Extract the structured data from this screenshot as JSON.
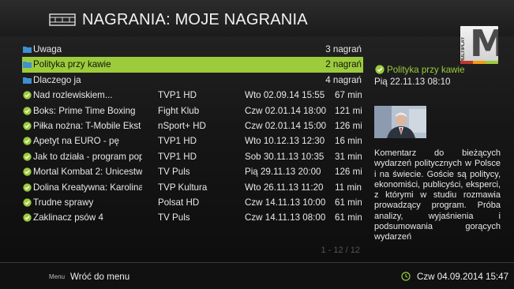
{
  "header": {
    "title": "NAGRANIA: MOJE NAGRANIA",
    "icon": "film-icon"
  },
  "logo": {
    "text": "M",
    "side_text": "MULTIPLAY",
    "bar_colors": [
      "#c0392b",
      "#f39c12",
      "#9ccb3b"
    ]
  },
  "colors": {
    "accent": "#9ccb3b",
    "folder": "#3f8fd2"
  },
  "folders": [
    {
      "name": "Uwaga",
      "count": "3 nagrań",
      "selected": false
    },
    {
      "name": "Polityka przy kawie",
      "count": "2 nagrań",
      "selected": true
    },
    {
      "name": "Dlaczego ja",
      "count": "4 nagrań",
      "selected": false
    }
  ],
  "recordings": [
    {
      "name": "Nad rozlewiskiem...",
      "channel": "TVP1 HD",
      "date": "Wto 02.09.14 15:55",
      "duration": "67 min"
    },
    {
      "name": "Boks: Prime Time Boxing",
      "channel": "Fight Klub",
      "date": "Czw 02.01.14 18:00",
      "duration": "121 min"
    },
    {
      "name": "Piłka nożna: T-Mobile Ekst",
      "channel": "nSport+ HD",
      "date": "Czw 02.01.14 15:00",
      "duration": "126 min"
    },
    {
      "name": "Apetyt na EURO - pę",
      "channel": "TVP1 HD",
      "date": "Wto 10.12.13 12:30",
      "duration": "16 min"
    },
    {
      "name": "Jak to działa - program pop",
      "channel": "TVP1 HD",
      "date": "Sob 30.11.13 10:35",
      "duration": "31 min"
    },
    {
      "name": "Mortal Kombat 2: Unicestw",
      "channel": "TV Puls",
      "date": "Pią 29.11.13 20:00",
      "duration": "126 min"
    },
    {
      "name": "Dolina Kreatywna: Karolina",
      "channel": "TVP Kultura",
      "date": "Wto 26.11.13 11:20",
      "duration": "11 min"
    },
    {
      "name": "Trudne sprawy",
      "channel": "Polsat HD",
      "date": "Czw 14.11.13 10:00",
      "duration": "61 min"
    },
    {
      "name": "Zaklinacz psów 4",
      "channel": "TV Puls",
      "date": "Czw 14.11.13 08:00",
      "duration": "61 min"
    }
  ],
  "pagination": "1 - 12 / 12",
  "details": {
    "title": "Polityka przy kawie",
    "date": "Pią 22.11.13 08:10",
    "description": "Komentarz do bieżących wydarzeń politycznych w Polsce i na świecie. Goście są politycy, ekonomiści, publicyści, eksperci, z którymi w studiu rozmawia prowadzący program. Próba analizy, wyjaśnienia i podsumowania gorących wydarzeń"
  },
  "footer": {
    "menu_key": "Menu",
    "menu_label": "Wróć do menu",
    "datetime": "Czw 04.09.2014 15:47"
  }
}
